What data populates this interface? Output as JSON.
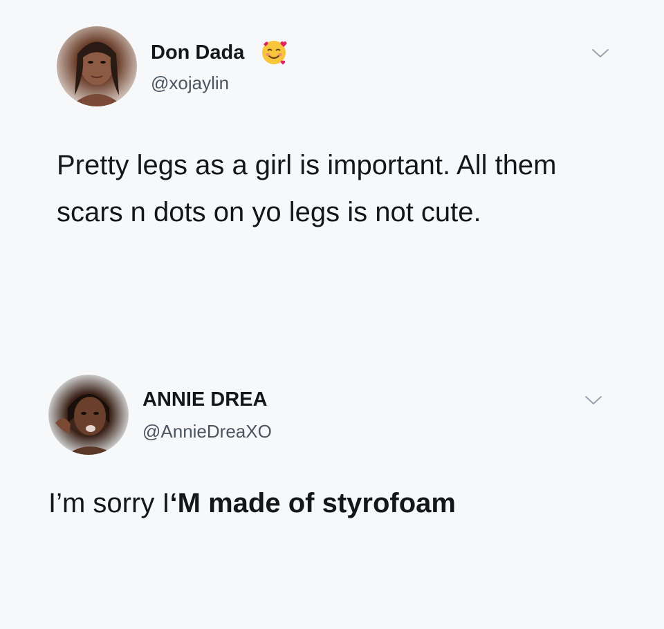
{
  "tweets": [
    {
      "display_name": "Don Dada",
      "emoji_icon": "smiling-face-with-hearts-icon",
      "handle": "@xojaylin",
      "text": "Pretty legs as a girl is important. All them scars n dots on yo legs is not cute."
    },
    {
      "display_name": "ANNIE DREA",
      "handle": "@AnnieDreaXO",
      "text_normal": "I’m sorry I",
      "text_bold": "‘M made of styrofoam"
    }
  ],
  "colors": {
    "background": "#f6f8fa",
    "text": "#14171a",
    "handle": "#4a5560",
    "chevron": "#98a4ae"
  }
}
